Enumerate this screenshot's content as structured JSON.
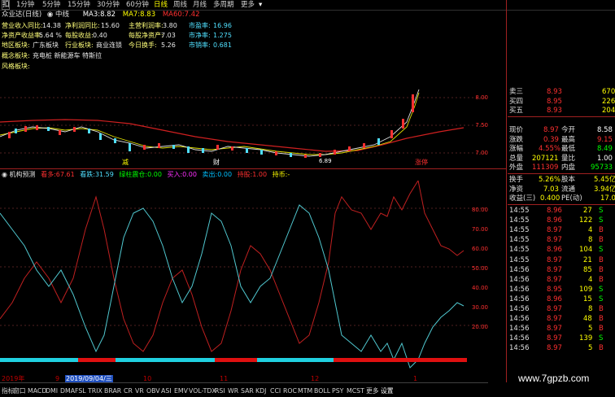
{
  "toolbar": {
    "items": [
      "1分钟",
      "5分钟",
      "15分钟",
      "30分钟",
      "60分钟",
      "日线",
      "周线",
      "月线",
      "多周期",
      "更多"
    ],
    "active_index": 5
  },
  "title": {
    "stock": "众业达(日线)",
    "period_tag": "中线",
    "ma": [
      {
        "label": "MA3:",
        "value": "8.82",
        "color": "#ffffff"
      },
      {
        "label": "MA7:",
        "value": "8.83",
        "color": "#ffff00"
      },
      {
        "label": "MA60:",
        "value": "7.42",
        "color": "#ff3030"
      }
    ]
  },
  "fundamentals": [
    [
      {
        "l": "营业收入同比:",
        "v": "14.38"
      },
      {
        "l": "净利润同比:",
        "v": "15.60"
      },
      {
        "l": "主营利润率:",
        "v": "3.80"
      },
      {
        "l": "市盈率:",
        "v": "16.96"
      }
    ],
    [
      {
        "l": "净资产收益率:",
        "v": "5.64 %"
      },
      {
        "l": "每股收益:",
        "v": "0.40"
      },
      {
        "l": "每股净资产:",
        "v": "7.03"
      },
      {
        "l": "市净率:",
        "v": "1.275"
      }
    ],
    [
      {
        "l": "地区板块:",
        "v": "广东板块"
      },
      {
        "l": "行业板块:",
        "v": "商业连锁"
      },
      {
        "l": "今日换手:",
        "v": "5.26"
      },
      {
        "l": "市销率:",
        "v": "0.681"
      }
    ]
  ],
  "concept": {
    "label": "概念板块:",
    "value": "充电桩 新能源车 特斯拉"
  },
  "style": {
    "label": "风格板块:"
  },
  "main_chart": {
    "price_axis": [
      "8.00",
      "7.50",
      "7.00"
    ],
    "labels": [
      "减",
      "财",
      "6.89",
      "涨停"
    ]
  },
  "indicator": {
    "title": "机构预测",
    "items": [
      {
        "l": "看多:",
        "v": "67.61",
        "c": "#ff3030"
      },
      {
        "l": "看跌:",
        "v": "31.59",
        "c": "#50e0ff"
      },
      {
        "l": "绿柱震仓:",
        "v": "0.00",
        "c": "#00ff00"
      },
      {
        "l": "买入:",
        "v": "0.00",
        "c": "#ff30ff"
      },
      {
        "l": "卖出:",
        "v": "0.00",
        "c": "#00c0ff"
      },
      {
        "l": "持股:",
        "v": "1.00",
        "c": "#ff3030"
      },
      {
        "l": "持币:",
        "v": "-",
        "c": "#ffff00"
      }
    ],
    "axis": [
      "80.00",
      "70.00",
      "60.00",
      "50.00",
      "40.00",
      "30.00",
      "20.00"
    ]
  },
  "dates": [
    "2019年",
    "9",
    "2019/09/04/三",
    "10",
    "11",
    "12",
    "1"
  ],
  "quote": {
    "asks": [
      {
        "n": "卖三",
        "p": "8.93",
        "v": "670"
      },
      {
        "n": "买四",
        "p": "8.95",
        "v": "226"
      },
      {
        "n": "买五",
        "p": "8.93",
        "v": "204"
      }
    ],
    "stats": [
      {
        "l": "现价",
        "v": "8.97",
        "l2": "今开",
        "v2": "8.58",
        "c": "#ff3030",
        "c2": "#ffffff"
      },
      {
        "l": "涨跌",
        "v": "0.39",
        "l2": "最高",
        "v2": "9.15",
        "c": "#ff3030",
        "c2": "#ff3030"
      },
      {
        "l": "涨幅",
        "v": "4.55%",
        "l2": "最低",
        "v2": "8.49",
        "c": "#ff3030",
        "c2": "#00ff00"
      },
      {
        "l": "总量",
        "v": "207121",
        "l2": "量比",
        "v2": "1.00",
        "c": "#ffff00",
        "c2": "#ffffff"
      },
      {
        "l": "外盘",
        "v": "111309",
        "l2": "内盘",
        "v2": "95733",
        "c": "#ff3030",
        "c2": "#00ff00"
      }
    ],
    "stats2": [
      {
        "l": "换手",
        "v": "5.26%",
        "l2": "股本",
        "v2": "5.45亿"
      },
      {
        "l": "净资",
        "v": "7.03",
        "l2": "流通",
        "v2": "3.94亿"
      },
      {
        "l": "收益(三)",
        "v": "0.400",
        "l2": "PE(动)",
        "v2": "17.0"
      }
    ],
    "ticks": [
      {
        "t": "14:55",
        "p": "8.96",
        "v": "27",
        "s": "S"
      },
      {
        "t": "14:55",
        "p": "8.96",
        "v": "122",
        "s": "S"
      },
      {
        "t": "14:55",
        "p": "8.97",
        "v": "4",
        "s": "B"
      },
      {
        "t": "14:55",
        "p": "8.97",
        "v": "8",
        "s": "B"
      },
      {
        "t": "14:55",
        "p": "8.96",
        "v": "104",
        "s": "S"
      },
      {
        "t": "14:55",
        "p": "8.97",
        "v": "21",
        "s": "B"
      },
      {
        "t": "14:56",
        "p": "8.97",
        "v": "85",
        "s": "B"
      },
      {
        "t": "14:56",
        "p": "8.97",
        "v": "4",
        "s": "B"
      },
      {
        "t": "14:56",
        "p": "8.95",
        "v": "109",
        "s": "S"
      },
      {
        "t": "14:56",
        "p": "8.96",
        "v": "15",
        "s": "S"
      },
      {
        "t": "14:56",
        "p": "8.97",
        "v": "8",
        "s": "B"
      },
      {
        "t": "14:56",
        "p": "8.97",
        "v": "48",
        "s": "B"
      },
      {
        "t": "14:56",
        "p": "8.97",
        "v": "5",
        "s": "B"
      },
      {
        "t": "14:56",
        "p": "8.97",
        "v": "139",
        "s": "S"
      },
      {
        "t": "14:56",
        "p": "8.97",
        "v": "5",
        "s": "B"
      }
    ]
  },
  "bottom_tabs": [
    "指标",
    "窗口",
    "MACD",
    "DMI",
    "DMA",
    "FSL",
    "TRIX",
    "BRAR",
    "CR",
    "VR",
    "OBV",
    "ASI",
    "EMV",
    "VOL-TDX",
    "RSI",
    "WR",
    "SAR",
    "KDJ",
    "CCI",
    "ROC",
    "MTM",
    "BOLL",
    "PSY",
    "MCST",
    "更多",
    "设置"
  ],
  "watermark": "www.7gpzb.com"
}
